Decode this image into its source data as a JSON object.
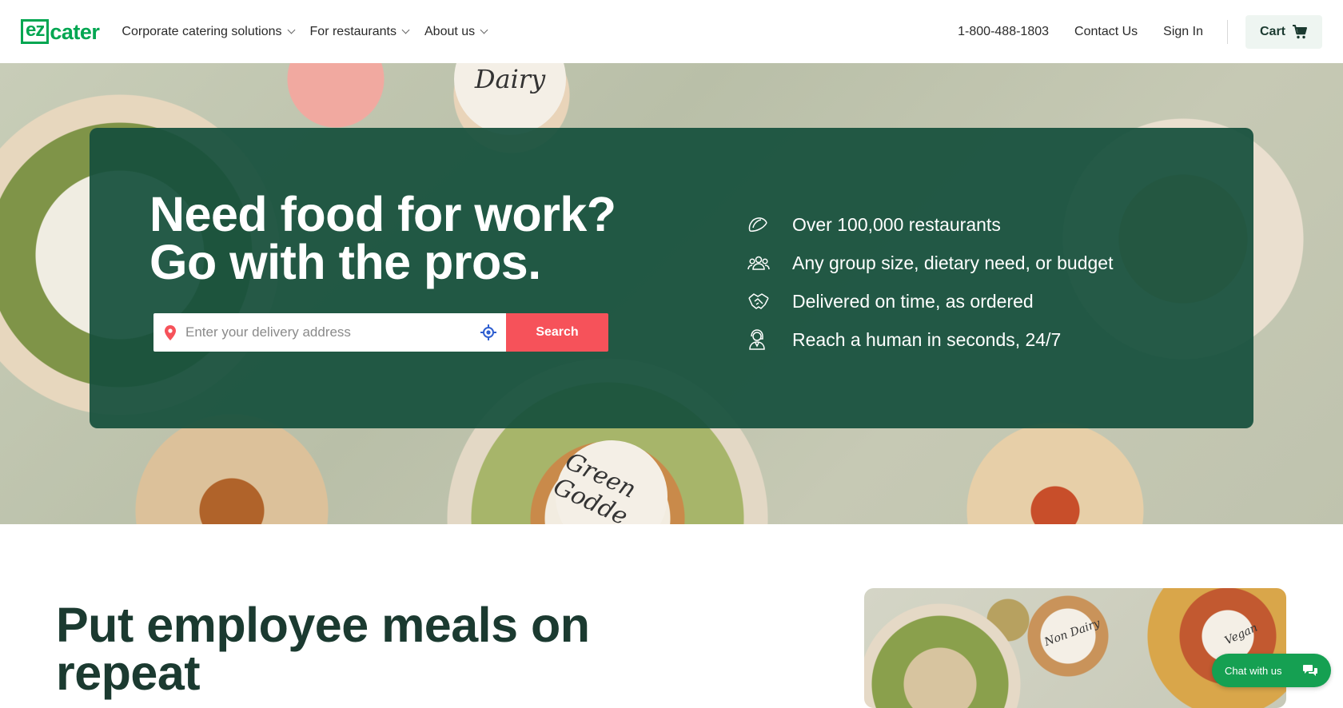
{
  "header": {
    "logo": {
      "ez": "ez",
      "cater": "cater"
    },
    "nav": [
      {
        "label": "Corporate catering solutions"
      },
      {
        "label": "For restaurants"
      },
      {
        "label": "About us"
      }
    ],
    "phone": "1-800-488-1803",
    "contact": "Contact Us",
    "signin": "Sign In",
    "cart": "Cart"
  },
  "hero": {
    "headline_line1": "Need food for work?",
    "headline_line2": "Go with the pros.",
    "search": {
      "placeholder": "Enter your delivery address",
      "button": "Search"
    },
    "image_labels": {
      "dairy": "Dairy",
      "green": "Green Godde"
    },
    "features": [
      {
        "icon": "taco-icon",
        "text": "Over 100,000 restaurants"
      },
      {
        "icon": "group-icon",
        "text": "Any group size, dietary need, or budget"
      },
      {
        "icon": "handshake-icon",
        "text": "Delivered on time, as ordered"
      },
      {
        "icon": "support-agent-icon",
        "text": "Reach a human in seconds, 24/7"
      }
    ]
  },
  "section": {
    "title_line1": "Put employee meals on",
    "title_line2": "repeat",
    "photo_labels": {
      "nondairy": "Non Dairy",
      "vegan": "Vegan"
    }
  },
  "chat": {
    "label": "Chat with us"
  },
  "colors": {
    "brand": "#00a651",
    "hero_card": "#15503c",
    "search_button": "#f6525a",
    "chat": "#15a052",
    "title": "#1b3a30"
  }
}
